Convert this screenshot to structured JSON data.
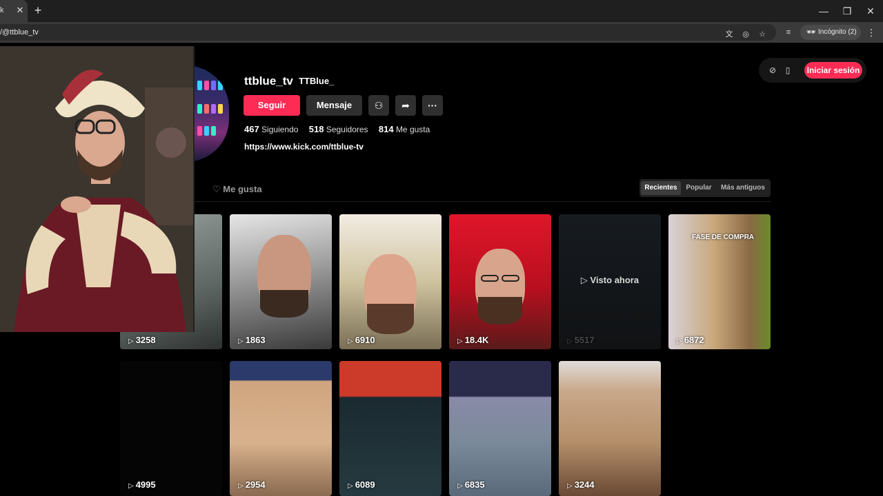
{
  "browser": {
    "tab_label": "k",
    "url": "/@ttblue_tv",
    "incognito_label": "Incógnito (2)"
  },
  "header": {
    "login_label": "Iniciar sesión"
  },
  "profile": {
    "username": "ttblue_tv",
    "nickname": "TTBlue_",
    "follow_label": "Seguir",
    "message_label": "Mensaje",
    "following_count": "467",
    "following_label": "Siguiendo",
    "followers_count": "518",
    "followers_label": "Seguidores",
    "likes_count": "814",
    "likes_label": "Me gusta",
    "bio_link": "https://www.kick.com/ttblue-tv"
  },
  "tabs": {
    "liked_label": "Me gusta"
  },
  "sort": {
    "options": [
      "Recientes",
      "Popular",
      "Más antiguos"
    ],
    "active": "Recientes"
  },
  "videos": [
    {
      "views": "3258"
    },
    {
      "views": "1863"
    },
    {
      "views": "6910"
    },
    {
      "views": "18.4K"
    },
    {
      "views": "5517",
      "overlay": "Visto ahora"
    },
    {
      "views": "6872",
      "caption": "FASE DE COMPRA"
    },
    {
      "views": "4995"
    },
    {
      "views": "2954"
    },
    {
      "views": "6089"
    },
    {
      "views": "6835"
    },
    {
      "views": "3244"
    }
  ],
  "colors": {
    "accent": "#fe2c55",
    "background": "#000000",
    "button_dark": "#2f2f2f"
  }
}
